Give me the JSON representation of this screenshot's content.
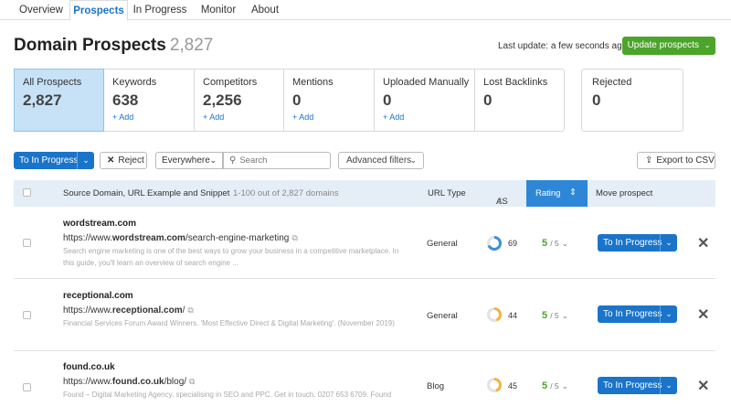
{
  "tabs": [
    "Overview",
    "Prospects",
    "In Progress",
    "Monitor",
    "About"
  ],
  "page_title": "Domain Prospects",
  "page_count": "2,827",
  "last_update": "Last update: a few seconds ago",
  "update_button": "Update prospects",
  "cards": [
    {
      "label": "All Prospects",
      "value": "2,827",
      "add": ""
    },
    {
      "label": "Keywords",
      "value": "638",
      "add": "+ Add"
    },
    {
      "label": "Competitors",
      "value": "2,256",
      "add": "+ Add"
    },
    {
      "label": "Mentions",
      "value": "0",
      "add": "+ Add"
    },
    {
      "label": "Uploaded Manually",
      "value": "0",
      "add": "+ Add"
    },
    {
      "label": "Lost Backlinks",
      "value": "0",
      "add": ""
    }
  ],
  "rejected": {
    "label": "Rejected",
    "value": "0"
  },
  "toolbar": {
    "to_in_progress": "To In Progress",
    "reject": "Reject",
    "scope": "Everywhere",
    "search_placeholder": "Search",
    "advanced_filters": "Advanced filters",
    "export": "Export to CSV"
  },
  "table": {
    "col_source": "Source Domain, URL Example and Snippet",
    "col_range": "1-100 out of 2,827 domains",
    "col_url_type": "URL Type",
    "col_as": "AS",
    "col_rating": "Rating",
    "col_move": "Move prospect"
  },
  "rows": [
    {
      "domain": "wordstream.com",
      "url_pre": "https://www.",
      "url_bold": "wordstream.com",
      "url_post": "/search-engine-marketing",
      "snippet1": "Search engine marketing is one of the best ways to grow your business in a competitive marketplace. In",
      "snippet2": "this guide, you'll learn an overview of search engine ...",
      "url_type": "General",
      "as": 69,
      "as_color": "#3b8fd9",
      "rating": "5",
      "rating_of": "/ 5",
      "move": "To In Progress"
    },
    {
      "domain": "receptional.com",
      "url_pre": "https://www.",
      "url_bold": "receptional.com",
      "url_post": "/",
      "snippet1": "Financial Services Forum Award Winners. 'Most Effective Direct & Digital Marketing'. (November 2019)",
      "snippet2": "",
      "url_type": "General",
      "as": 44,
      "as_color": "#f0b43c",
      "rating": "5",
      "rating_of": "/ 5",
      "move": "To In Progress"
    },
    {
      "domain": "found.co.uk",
      "url_pre": "https://www.",
      "url_bold": "found.co.uk",
      "url_post": "/blog/",
      "snippet1": "Found – Digital Marketing Agency, specialising in SEO and PPC. Get in touch. 0207 653 6709. Found",
      "snippet2": "",
      "url_type": "Blog",
      "as": 45,
      "as_color": "#f0b43c",
      "rating": "5",
      "rating_of": "/ 5",
      "move": "To In Progress"
    }
  ]
}
